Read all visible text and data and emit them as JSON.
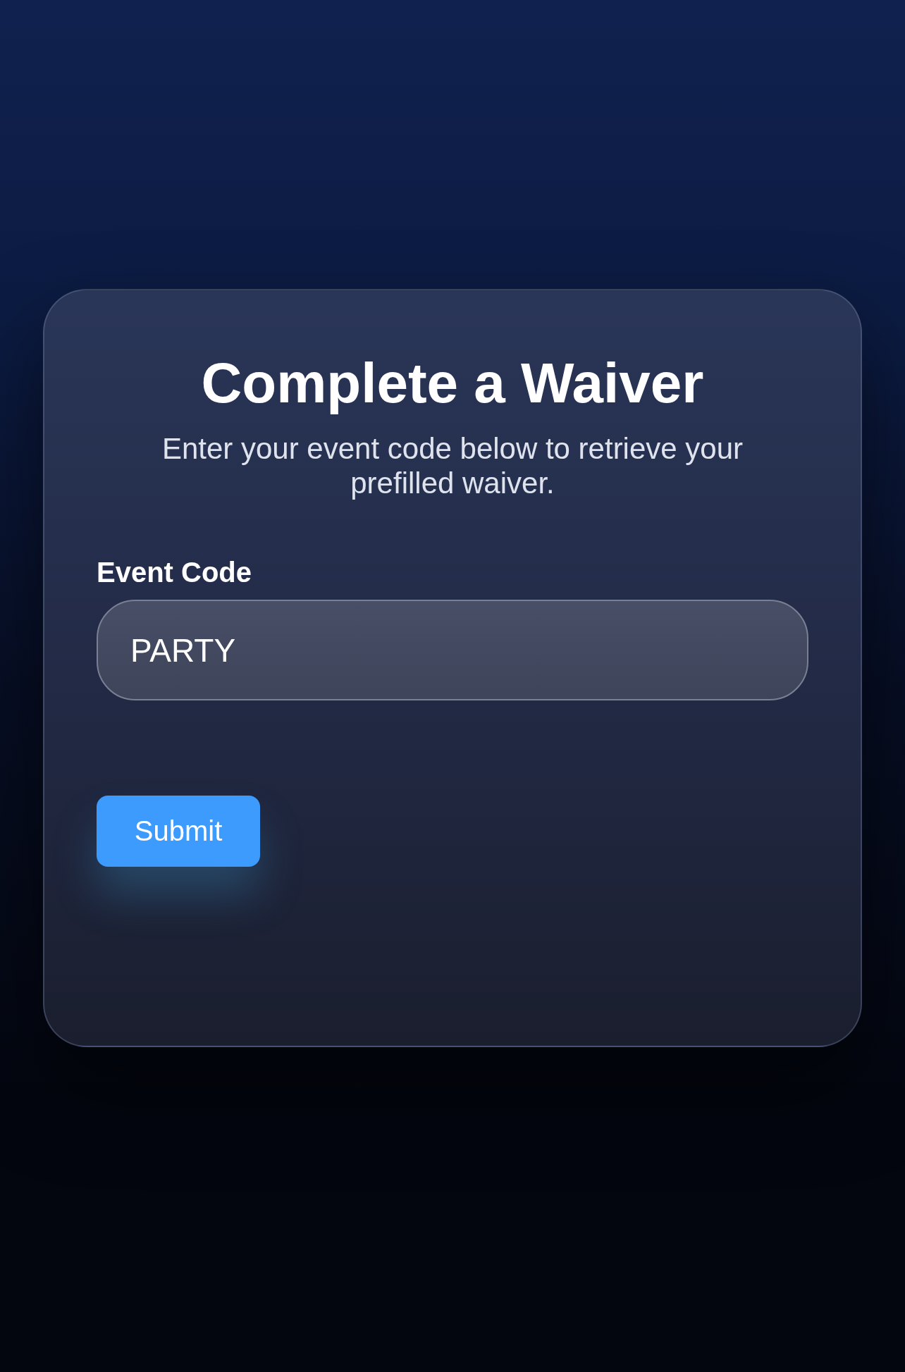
{
  "card": {
    "title": "Complete a Waiver",
    "subtitle": "Enter your event code below to retrieve your prefilled waiver."
  },
  "event_code_field": {
    "label": "Event Code",
    "value": "PARTY"
  },
  "submit_button": {
    "label": "Submit"
  }
}
